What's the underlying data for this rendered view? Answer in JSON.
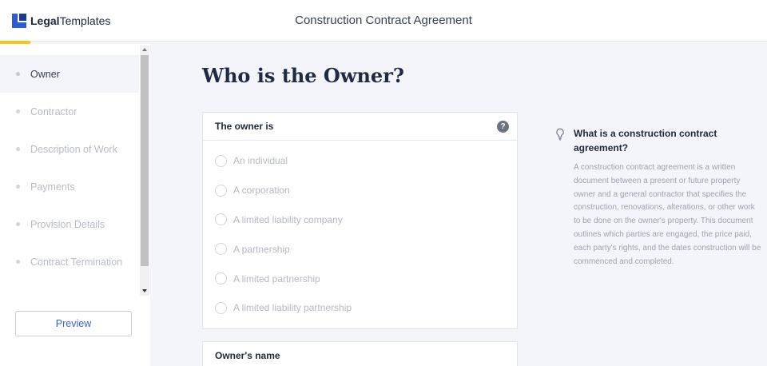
{
  "header": {
    "brand_bold": "Legal",
    "brand_rest": "Templates",
    "title": "Construction Contract Agreement"
  },
  "progress": {
    "fraction": 0.04,
    "color": "#f5c518"
  },
  "sidebar": {
    "items": [
      {
        "label": "Owner",
        "active": true
      },
      {
        "label": "Contractor",
        "active": false
      },
      {
        "label": "Description of Work",
        "active": false
      },
      {
        "label": "Payments",
        "active": false
      },
      {
        "label": "Provision Details",
        "active": false
      },
      {
        "label": "Contract Termination",
        "active": false
      }
    ],
    "preview_label": "Preview"
  },
  "main": {
    "title": "Who is the Owner?",
    "question": {
      "label": "The owner is",
      "help": "?",
      "options": [
        "An individual",
        "A corporation",
        "A limited liability company",
        "A partnership",
        "A limited partnership",
        "A limited liability partnership"
      ]
    },
    "next_question": {
      "label": "Owner's name"
    }
  },
  "info": {
    "icon": "lightbulb-icon",
    "title": "What is a construction contract agreement?",
    "body": "A construction contract agreement is a written document between a present or future property owner and a general contractor that specifies the construction, renovations, alterations, or other work to be done on the owner's property. This document outlines which parties are engaged, the price paid, each party's rights, and the dates construction will be commenced and completed."
  },
  "colors": {
    "accent": "#2b5cd4",
    "link": "#3b5fc8"
  }
}
